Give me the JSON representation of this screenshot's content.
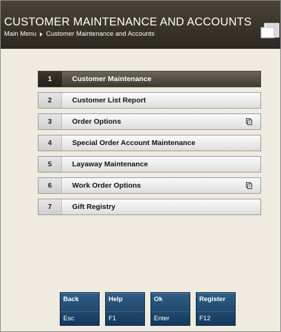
{
  "header": {
    "title": "CUSTOMER MAINTENANCE AND ACCOUNTS",
    "breadcrumb": [
      "Main Menu",
      "Customer Maintenance and Accounts"
    ]
  },
  "menu": {
    "items": [
      {
        "number": "1",
        "label": "Customer Maintenance",
        "active": true,
        "submenu": false
      },
      {
        "number": "2",
        "label": "Customer List Report",
        "active": false,
        "submenu": false
      },
      {
        "number": "3",
        "label": "Order Options",
        "active": false,
        "submenu": true
      },
      {
        "number": "4",
        "label": "Special Order Account Maintenance",
        "active": false,
        "submenu": false
      },
      {
        "number": "5",
        "label": "Layaway Maintenance",
        "active": false,
        "submenu": false
      },
      {
        "number": "6",
        "label": "Work Order Options",
        "active": false,
        "submenu": true
      },
      {
        "number": "7",
        "label": "Gift Registry",
        "active": false,
        "submenu": false
      }
    ]
  },
  "function_keys": [
    {
      "label": "Back",
      "key": "Esc"
    },
    {
      "label": "Help",
      "key": "F1"
    },
    {
      "label": "Ok",
      "key": "Enter"
    },
    {
      "label": "Register",
      "key": "F12"
    }
  ],
  "colors": {
    "header_bg": "#3a352b",
    "content_bg": "#f0ebe0",
    "active_item_bg": "#4e4a3e",
    "fkey_bg": "#1f4a70"
  },
  "icons": {
    "window": "window-icon",
    "submenu": "submenu-icon"
  }
}
